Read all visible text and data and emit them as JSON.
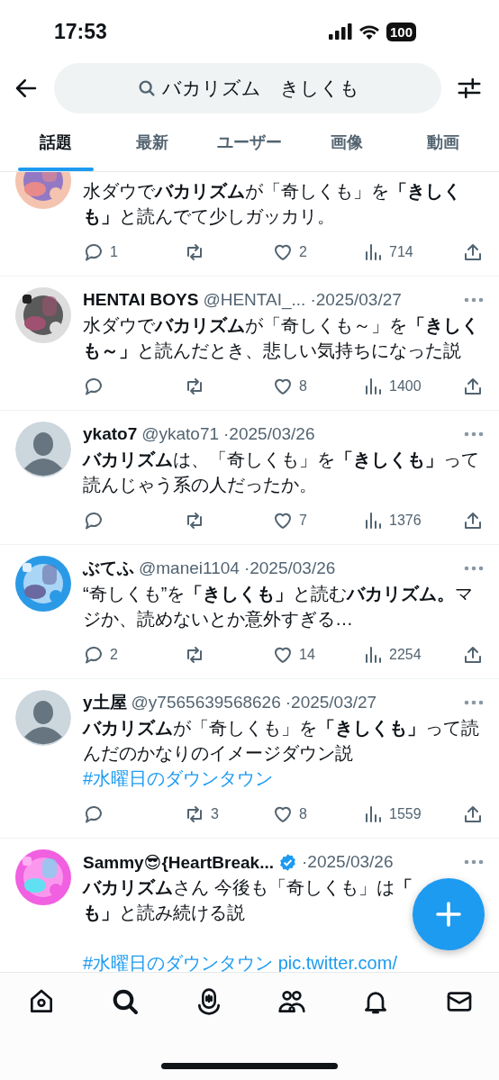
{
  "status_bar": {
    "time": "17:53",
    "battery": "100"
  },
  "search": {
    "value": "バカリズム　きしくも"
  },
  "tabs": [
    {
      "label": "話題",
      "selected": true
    },
    {
      "label": "最新",
      "selected": false
    },
    {
      "label": "ユーザー",
      "selected": false
    },
    {
      "label": "画像",
      "selected": false
    },
    {
      "label": "動画",
      "selected": false
    }
  ],
  "tweets": [
    {
      "header_hidden": true,
      "body": "水ダウで**バカリズム**が「奇しくも」を**「きしくも」**と読んでて少しガッカリ。",
      "replies": "1",
      "likes": "2",
      "views": "714"
    },
    {
      "header_hidden": false,
      "name": "HENTAI BOYS",
      "handle": "@HENTAI_...",
      "date": "·2025/03/27",
      "verified": false,
      "body": "水ダウで**バカリズム**が「奇しくも～」を**「きしくも～」**と読んだとき、悲しい気持ちになった説",
      "likes": "8",
      "views": "1400"
    },
    {
      "avatar": {
        "kind": "default"
      },
      "header_hidden": false,
      "name": "ykato7",
      "handle": "@ykato71",
      "date": "·2025/03/26",
      "verified": false,
      "body": "**バカリズム**は、「奇しくも」を**「きしくも」**って読んじゃう系の人だったか。",
      "likes": "7",
      "views": "1376"
    },
    {
      "header_hidden": false,
      "name": "ぶてふ",
      "handle": "@manei1104",
      "date": "·2025/03/26",
      "verified": false,
      "body": "“奇しくも”を**「きしくも」**と読む**バカリズム。**マジか、読めないとか意外すぎる…",
      "replies": "2",
      "likes": "14",
      "views": "2254"
    },
    {
      "avatar": {
        "kind": "default"
      },
      "header_hidden": false,
      "name": "y土屋",
      "handle": "@y7565639568626",
      "date": "·2025/03/27",
      "verified": false,
      "body": "**バカリズム**が「奇しくも」を**「きしくも」**って読んだのかなりのイメージダウン説",
      "links": [
        "#水曜日のダウンタウン"
      ],
      "retweets": "3",
      "likes": "8",
      "views": "1559"
    },
    {
      "header_hidden": false,
      "name": "Sammy😎{HeartBreak...",
      "date": "·2025/03/26",
      "verified": true,
      "body_lines": [
        "**バカリズム**さん 今後も「奇しくも」は**「**",
        "**も」**と読み続ける説"
      ],
      "links_block": [
        "#水曜日のダウンタウン",
        "pic.twitter.com/"
      ]
    }
  ]
}
